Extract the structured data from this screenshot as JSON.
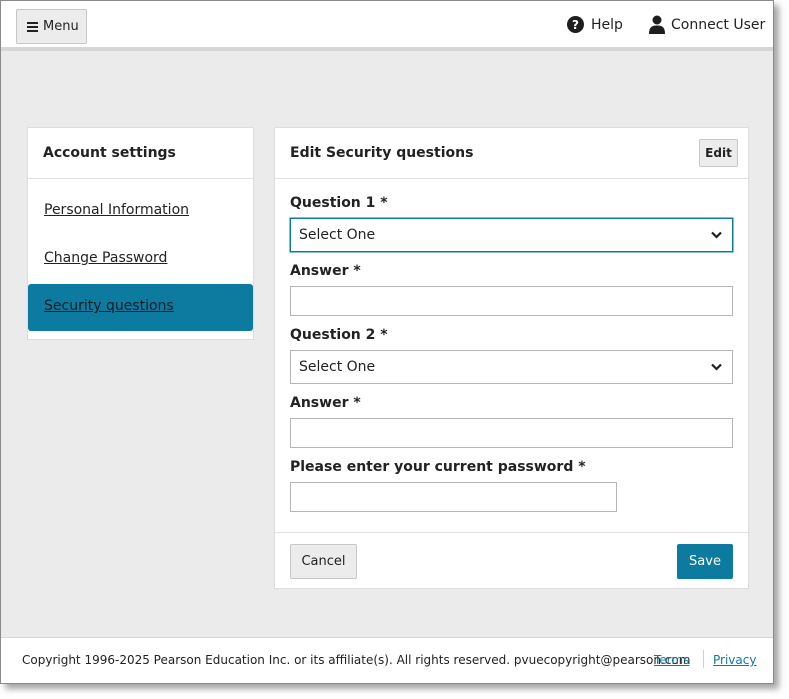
{
  "header": {
    "menu_label": "Menu",
    "help_label": "Help",
    "user_label": "Connect User"
  },
  "sidebar": {
    "title": "Account settings",
    "items": [
      {
        "label": "Personal Information"
      },
      {
        "label": "Change Password"
      },
      {
        "label": "Security questions",
        "active": true
      }
    ]
  },
  "main": {
    "title": "Edit Security questions",
    "edit_label": "Edit",
    "question1_label": "Question 1 *",
    "question1_value": "Select One",
    "answer1_label": "Answer *",
    "answer1_value": "",
    "question2_label": "Question 2 *",
    "question2_value": "Select One",
    "answer2_label": "Answer *",
    "answer2_value": "",
    "password_label": "Please enter your current password *",
    "password_value": "",
    "cancel_label": "Cancel",
    "save_label": "Save"
  },
  "footer": {
    "copyright": "Copyright 1996-2025 Pearson Education Inc. or its affiliate(s). All rights reserved. pvuecopyright@pearson.com",
    "terms_label": "Terms",
    "privacy_label": "Privacy"
  },
  "colors": {
    "accent": "#0d7ba0",
    "background": "#ebebeb",
    "card": "#ffffff"
  },
  "icons": [
    "hamburger-icon",
    "help-icon",
    "user-icon",
    "chevron-down-icon"
  ]
}
